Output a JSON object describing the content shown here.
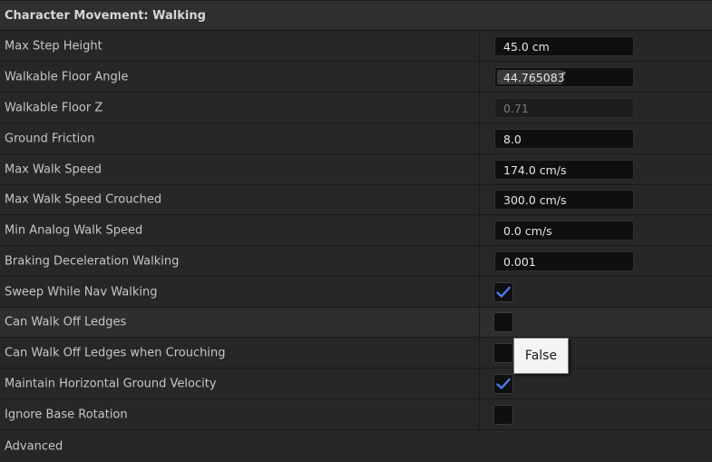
{
  "section": {
    "title": "Character Movement: Walking"
  },
  "properties": [
    {
      "label": "Max Step Height",
      "value": "45.0 cm"
    },
    {
      "label": "Walkable Floor Angle",
      "value": "44.765083",
      "unit": "°"
    },
    {
      "label": "Walkable Floor Z",
      "value": "0.71"
    },
    {
      "label": "Ground Friction",
      "value": "8.0"
    },
    {
      "label": "Max Walk Speed",
      "value": "174.0 cm/s"
    },
    {
      "label": "Max Walk Speed Crouched",
      "value": "300.0 cm/s"
    },
    {
      "label": "Min Analog Walk Speed",
      "value": "0.0 cm/s"
    },
    {
      "label": "Braking Deceleration Walking",
      "value": "0.001"
    },
    {
      "label": "Sweep While Nav Walking",
      "checked": true
    },
    {
      "label": "Can Walk Off Ledges",
      "checked": false
    },
    {
      "label": "Can Walk Off Ledges when Crouching",
      "checked": false
    },
    {
      "label": "Maintain Horizontal Ground Velocity",
      "checked": true
    },
    {
      "label": "Ignore Base Rotation",
      "checked": false
    }
  ],
  "advanced": {
    "label": "Advanced"
  },
  "tooltip": {
    "text": "False"
  },
  "colors": {
    "checkmark": "#4a7de8",
    "background": "#242424",
    "field": "#0f0f0f"
  }
}
